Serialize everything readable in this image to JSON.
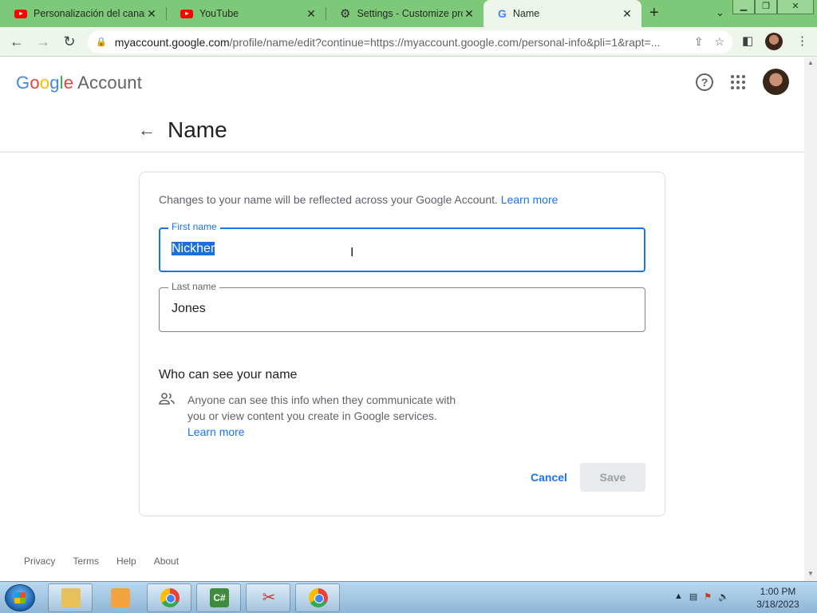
{
  "browser": {
    "tabs": [
      {
        "title": "Personalización del canal",
        "icon": "youtube-icon"
      },
      {
        "title": "YouTube",
        "icon": "youtube-icon"
      },
      {
        "title": "Settings - Customize prof",
        "icon": "gear-icon"
      },
      {
        "title": "Name",
        "icon": "google-icon",
        "active": true
      }
    ],
    "url_domain": "myaccount.google.com",
    "url_rest": "/profile/name/edit?continue=https://myaccount.google.com/personal-info&pli=1&rapt=..."
  },
  "header": {
    "logo_google": "Google",
    "logo_account": "Account"
  },
  "page": {
    "title": "Name",
    "intro_text": "Changes to your name will be reflected across your Google Account.",
    "intro_link": "Learn more",
    "first_name_label": "First name",
    "first_name_value": "Nickher",
    "last_name_label": "Last name",
    "last_name_value": "Jones",
    "visibility_title": "Who can see your name",
    "visibility_text": "Anyone can see this info when they communicate with you or view content you create in Google services.",
    "visibility_link": "Learn more",
    "cancel_label": "Cancel",
    "save_label": "Save"
  },
  "footer": {
    "links": [
      "Privacy",
      "Terms",
      "Help",
      "About"
    ]
  },
  "taskbar": {
    "time": "1:00 PM",
    "date": "3/18/2023",
    "cs_label": "C#"
  },
  "colors": {
    "accent": "#1a73e8",
    "tabstrip": "#7ec87a"
  }
}
